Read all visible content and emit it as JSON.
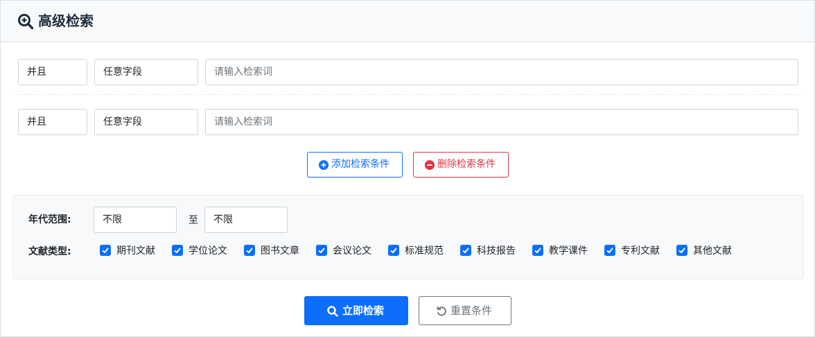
{
  "header": {
    "title": "高级检索",
    "icon": "search-plus-icon"
  },
  "conditions": [
    {
      "logic": "并且",
      "field": "任意字段",
      "placeholder": "请输入检索词",
      "value": ""
    },
    {
      "logic": "并且",
      "field": "任意字段",
      "placeholder": "请输入检索词",
      "value": ""
    }
  ],
  "actions": {
    "add_label": "添加检索条件",
    "delete_label": "删除检索条件"
  },
  "filters": {
    "year_label": "年代范围:",
    "year_from": "不限",
    "year_sep": "至",
    "year_to": "不限",
    "type_label": "文献类型:",
    "types": [
      {
        "label": "期刊文献",
        "checked": true
      },
      {
        "label": "学位论文",
        "checked": true
      },
      {
        "label": "图书文章",
        "checked": true
      },
      {
        "label": "会议论文",
        "checked": true
      },
      {
        "label": "标准规范",
        "checked": true
      },
      {
        "label": "科技报告",
        "checked": true
      },
      {
        "label": "教学课件",
        "checked": true
      },
      {
        "label": "专利文献",
        "checked": true
      },
      {
        "label": "其他文献",
        "checked": true
      }
    ]
  },
  "footer": {
    "search_label": "立即检索",
    "reset_label": "重置条件"
  },
  "colors": {
    "primary": "#0d6efd",
    "danger": "#dc3545",
    "secondary": "#6c757d"
  }
}
